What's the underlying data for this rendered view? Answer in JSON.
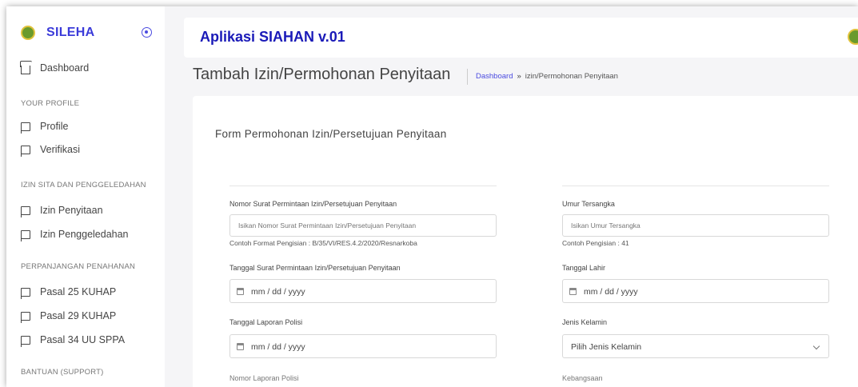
{
  "sidebar": {
    "brand": "SILEHA",
    "dashboard": "Dashboard",
    "section_profile": "YOUR PROFILE",
    "profile": "Profile",
    "verifikasi": "Verifikasi",
    "section_izin": "IZIN SITA DAN PENGGELEDAHAN",
    "izin_penyitaan": "Izin Penyitaan",
    "izin_penggeledahan": "Izin Penggeledahan",
    "section_perpanjangan": "PERPANJANGAN PENAHANAN",
    "pasal25": "Pasal 25 KUHAP",
    "pasal29": "Pasal 29 KUHAP",
    "pasal34": "Pasal 34 UU SPPA",
    "section_bantuan": "BANTUAN (SUPPORT)"
  },
  "header": {
    "app_title": "Aplikasi SIAHAN v.01"
  },
  "page": {
    "title": "Tambah Izin/Permohonan Penyitaan",
    "breadcrumb_home": "Dashboard",
    "breadcrumb_sep": "»",
    "breadcrumb_current": "izin/Permohonan Penyitaan"
  },
  "form": {
    "title": "Form Permohonan Izin/Persetujuan Penyitaan",
    "nomor_surat": {
      "label": "Nomor Surat Permintaan Izin/Persetujuan Penyitaan",
      "placeholder": "Isikan Nomor Surat Permintaan Izin/Persetujuan Penyitaan",
      "hint": "Contoh Format Pengisian : B/35/VI/RES.4.2/2020/Resnarkoba"
    },
    "umur": {
      "label": "Umur Tersangka",
      "placeholder": "Isikan Umur Tersangka",
      "hint": "Contoh Pengisian : 41"
    },
    "tanggal_surat": {
      "label": "Tanggal Surat Permintaan Izin/Persetujuan Penyitaan",
      "value": "mm / dd / yyyy"
    },
    "tanggal_lahir": {
      "label": "Tanggal Lahir",
      "value": "mm / dd / yyyy"
    },
    "tanggal_laporan": {
      "label": "Tanggal Laporan Polisi",
      "value": "mm / dd / yyyy"
    },
    "jenis_kelamin": {
      "label": "Jenis Kelamin",
      "selected": "Pilih Jenis Kelamin"
    },
    "nomor_laporan": {
      "label": "Nomor Laporan Polisi"
    },
    "kebangsaan": {
      "label": "Kebangsaan"
    }
  },
  "colors": {
    "brand": "#3b3bd9",
    "app_title": "#1a1ab8",
    "link": "#4b4be0"
  }
}
